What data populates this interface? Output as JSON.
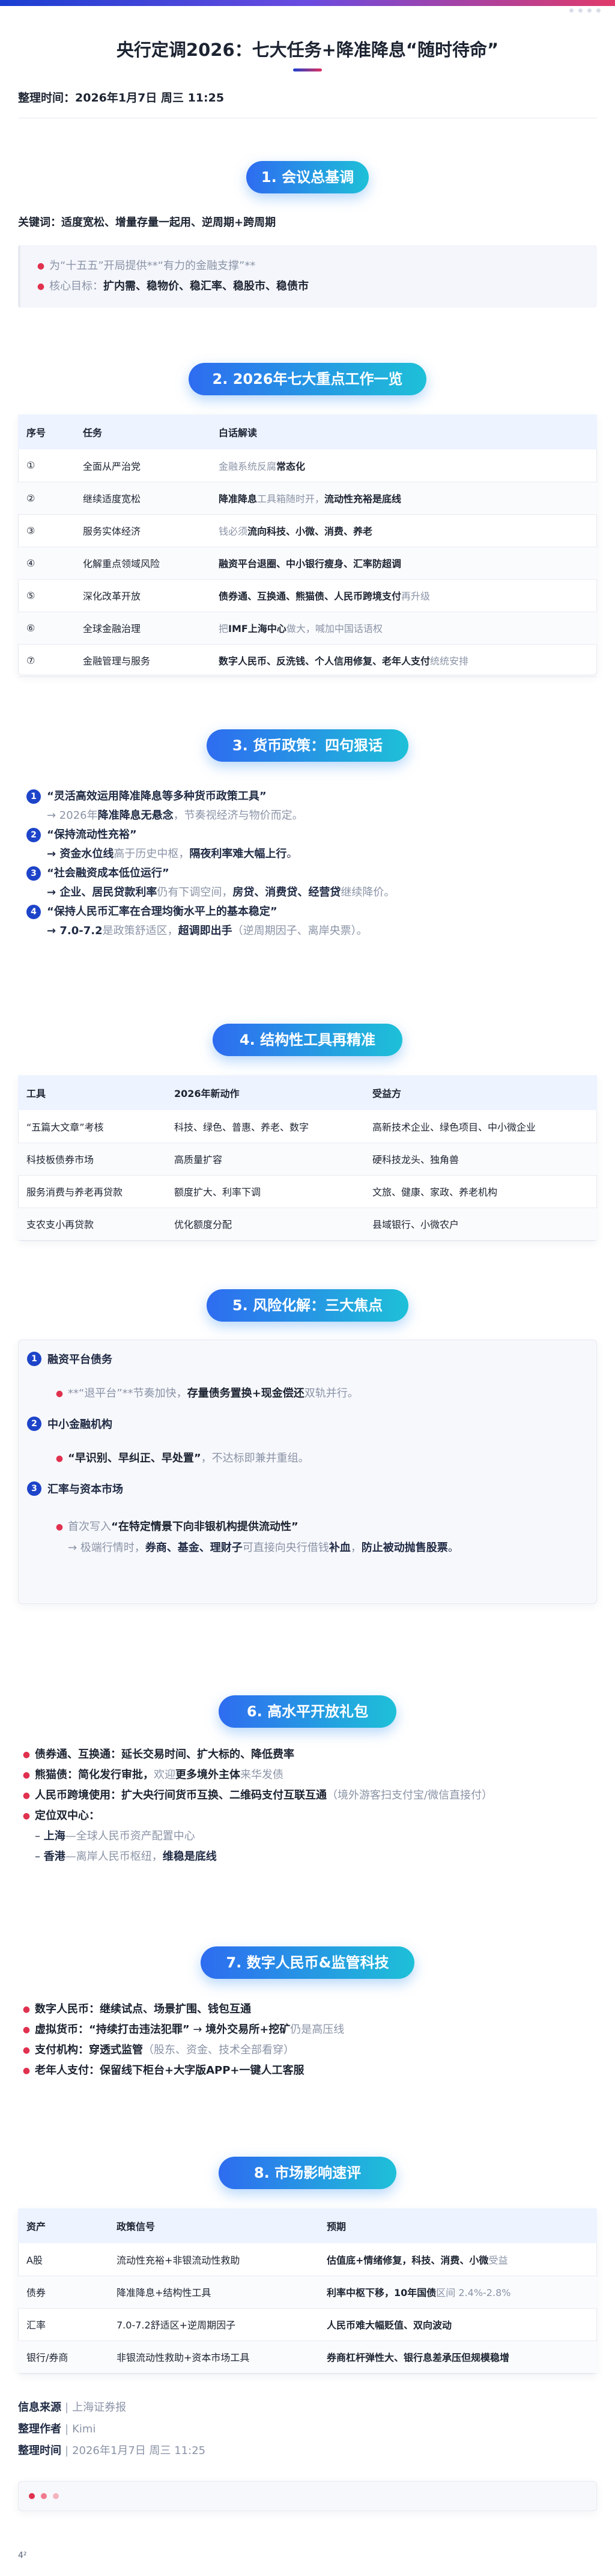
{
  "title": "央行定调2026：七大任务+降准降息“随时待命”",
  "meta": {
    "label": "整理时间：",
    "value": "2026年1月7日 周三 11:25"
  },
  "s1": {
    "pill": "1. 会议总基调",
    "keywords_label": "关键词：",
    "keywords_value": "适度宽松、增量存量一起用、逆周期+跨周期",
    "b1a": "为“十五五”开局提供**“有力的金融支撑”**",
    "b2a": "核心目标：",
    "b2b": "扩内需、稳物价、稳汇率、稳股市、稳债市"
  },
  "s2": {
    "pill": "2. 2026年七大重点工作一览",
    "headers": [
      "序号",
      "任务",
      "白话解读"
    ],
    "rows": [
      {
        "n": "①",
        "task": "全面从严治党",
        "a": "金融系统反腐",
        "b": "常态化",
        "c": ""
      },
      {
        "n": "②",
        "task": "继续适度宽松",
        "a": "降准降息",
        "b": "工具箱随时开，",
        "c": "流动性充裕是底线"
      },
      {
        "n": "③",
        "task": "服务实体经济",
        "a": "钱必须",
        "b": "流向科技、小微、消费、养老",
        "c": ""
      },
      {
        "n": "④",
        "task": "化解重点领域风险",
        "a": "",
        "b": "融资平台退圈、中小银行瘦身、汇率防超调",
        "c": ""
      },
      {
        "n": "⑤",
        "task": "深化改革开放",
        "a": "",
        "b": "债券通、互换通、熊猫债、人民币跨境支付",
        "c": "再升级"
      },
      {
        "n": "⑥",
        "task": "全球金融治理",
        "a": "把",
        "b": "IMF上海中心",
        "c": "做大，喊加中国话语权"
      },
      {
        "n": "⑦",
        "task": "金融管理与服务",
        "a": "",
        "b": "数字人民币、反洗钱、个人信用修复、老年人支付",
        "c": "统统安排"
      }
    ]
  },
  "s3": {
    "pill": "3. 货币政策：四句狠话",
    "items": [
      {
        "q": "“灵活高效运用降准降息等多种货币政策工具”",
        "l1": "→ 2026年",
        "l2": "降准降息无悬念",
        "l3": "，节奏视经济与物价而定。"
      },
      {
        "q": "“保持流动性充裕”",
        "l1": "→ ",
        "l2": "资金水位线",
        "l3": "高于历史中枢，",
        "l4": "隔夜利率难大幅上行",
        "l5": "。"
      },
      {
        "q": "“社会融资成本低位运行”",
        "l1": "→ ",
        "l2": "企业、居民贷款利率",
        "l3": "仍有下调空间，",
        "l4": "房贷、消费贷、经营贷",
        "l5": "继续降价。"
      },
      {
        "q": "“保持人民币汇率在合理均衡水平上的基本稳定”",
        "l1": "→ ",
        "l2": "7.0-7.2",
        "l3": "是政策舒适区，",
        "l4": "超调即出手",
        "l5": "（逆周期因子、离岸央票）。"
      }
    ]
  },
  "s4": {
    "pill": "4. 结构性工具再精准",
    "headers": [
      "工具",
      "2026年新动作",
      "受益方"
    ],
    "rows": [
      {
        "a": "“五篇大文章”考核",
        "b": "科技、绿色、普惠、养老、数字",
        "c": "高新技术企业、绿色项目、中小微企业"
      },
      {
        "a": "科技板债券市场",
        "b": "高质量扩容",
        "c": "硬科技龙头、独角兽"
      },
      {
        "a": "服务消费与养老再贷款",
        "b": "额度扩大、利率下调",
        "c": "文旅、健康、家政、养老机构"
      },
      {
        "a": "支农支小再贷款",
        "b": "优化额度分配",
        "c": "县域银行、小微农户"
      }
    ]
  },
  "s5": {
    "pill": "5. 风险化解：三大焦点",
    "items": [
      {
        "h": "融资平台债务",
        "a": "**“退平台”**节奏加快，",
        "b": "存量债务置换+现金偿还",
        "c": "双轨并行。"
      },
      {
        "h": "中小金融机构",
        "a": "",
        "b": "“早识别、早纠正、早处置”",
        "c": "，不达标即兼并重组。"
      },
      {
        "h": "汇率与资本市场",
        "a": "首次写入",
        "b": "“在特定情景下向非银机构提供流动性”",
        "c": ""
      }
    ],
    "arrow_a": "→ 极端行情时，",
    "arrow_b": "券商、基金、理财子",
    "arrow_c": "可直接向央行借钱",
    "arrow_d": "补血",
    "arrow_e": "，",
    "arrow_f": "防止被动抛售股票",
    "arrow_g": "。"
  },
  "s6": {
    "pill": "6. 高水平开放礼包",
    "b1a": "债券通、互换通：",
    "b1b": "延长交易时间、扩大标的、降低费率",
    "b2a": "熊猫债：",
    "b2b": "简化发行审批，",
    "b2c": "欢迎",
    "b2d": "更多境外主体",
    "b2e": "来华发债",
    "b3a": "人民币跨境使用：",
    "b3b": "扩大央行间货币互换、",
    "b3c": "二维码支付互联互通",
    "b3d": "（境外游客扫支付宝/微信直接付）",
    "b4a": "定位双中心：",
    "d1a": "– ",
    "d1b": "上海",
    "d1c": "—全球人民币资产配置中心",
    "d2a": "– ",
    "d2b": "香港",
    "d2c": "—离岸人民币枢纽，",
    "d2d": "维稳是底线"
  },
  "s7": {
    "pill": "7. 数字人民币&监管科技",
    "b1a": "数字人民币：",
    "b1b": "继续试点、场景扩围、钱包互通",
    "b2a": "虚拟货币：",
    "b2b": "“持续打击违法犯罪”",
    "b2c": " → ",
    "b2d": "境外交易所+挖矿",
    "b2e": "仍是高压线",
    "b3a": "支付机构：",
    "b3b": "穿透式监管",
    "b3c": "（股东、资金、技术全部看穿）",
    "b4a": "老年人支付：",
    "b4b": "保留线下柜台+大字版APP+一键人工客服"
  },
  "s8": {
    "pill": "8. 市场影响速评",
    "headers": [
      "资产",
      "政策信号",
      "预期"
    ],
    "rows": [
      {
        "a": "A股",
        "b": "流动性充裕+非银流动性救助",
        "c1": "估值底+情绪修复，",
        "c2": "科技、消费、小微",
        "c3": "受益"
      },
      {
        "a": "债券",
        "b": "降准降息+结构性工具",
        "c1": "利率中枢下移，",
        "c2": "10年国债",
        "c3": "区间 2.4%-2.8%"
      },
      {
        "a": "汇率",
        "b": "7.0-7.2舒适区+逆周期因子",
        "c1": "人民币难大幅贬值、",
        "c2": "双向波动",
        "c3": ""
      },
      {
        "a": "银行/券商",
        "b": "非银流动性救助+资本市场工具",
        "c1": "券商杠杆弹性大、",
        "c2": "银行息差承压但规模稳增",
        "c3": ""
      }
    ]
  },
  "footer": {
    "src_label": "信息来源",
    "src_value": "上海证券报",
    "author_label": "整理作者",
    "author_value": "Kimi",
    "time_label": "整理时间",
    "time_value": "2026年1月7日 周三 11:25"
  },
  "page_number": "4²",
  "colors": {
    "accent_blue": "#1d44c9",
    "pill_start": "#2e6cf0",
    "pill_end": "#1ec0d8",
    "bullet_red": "#e0314e"
  }
}
